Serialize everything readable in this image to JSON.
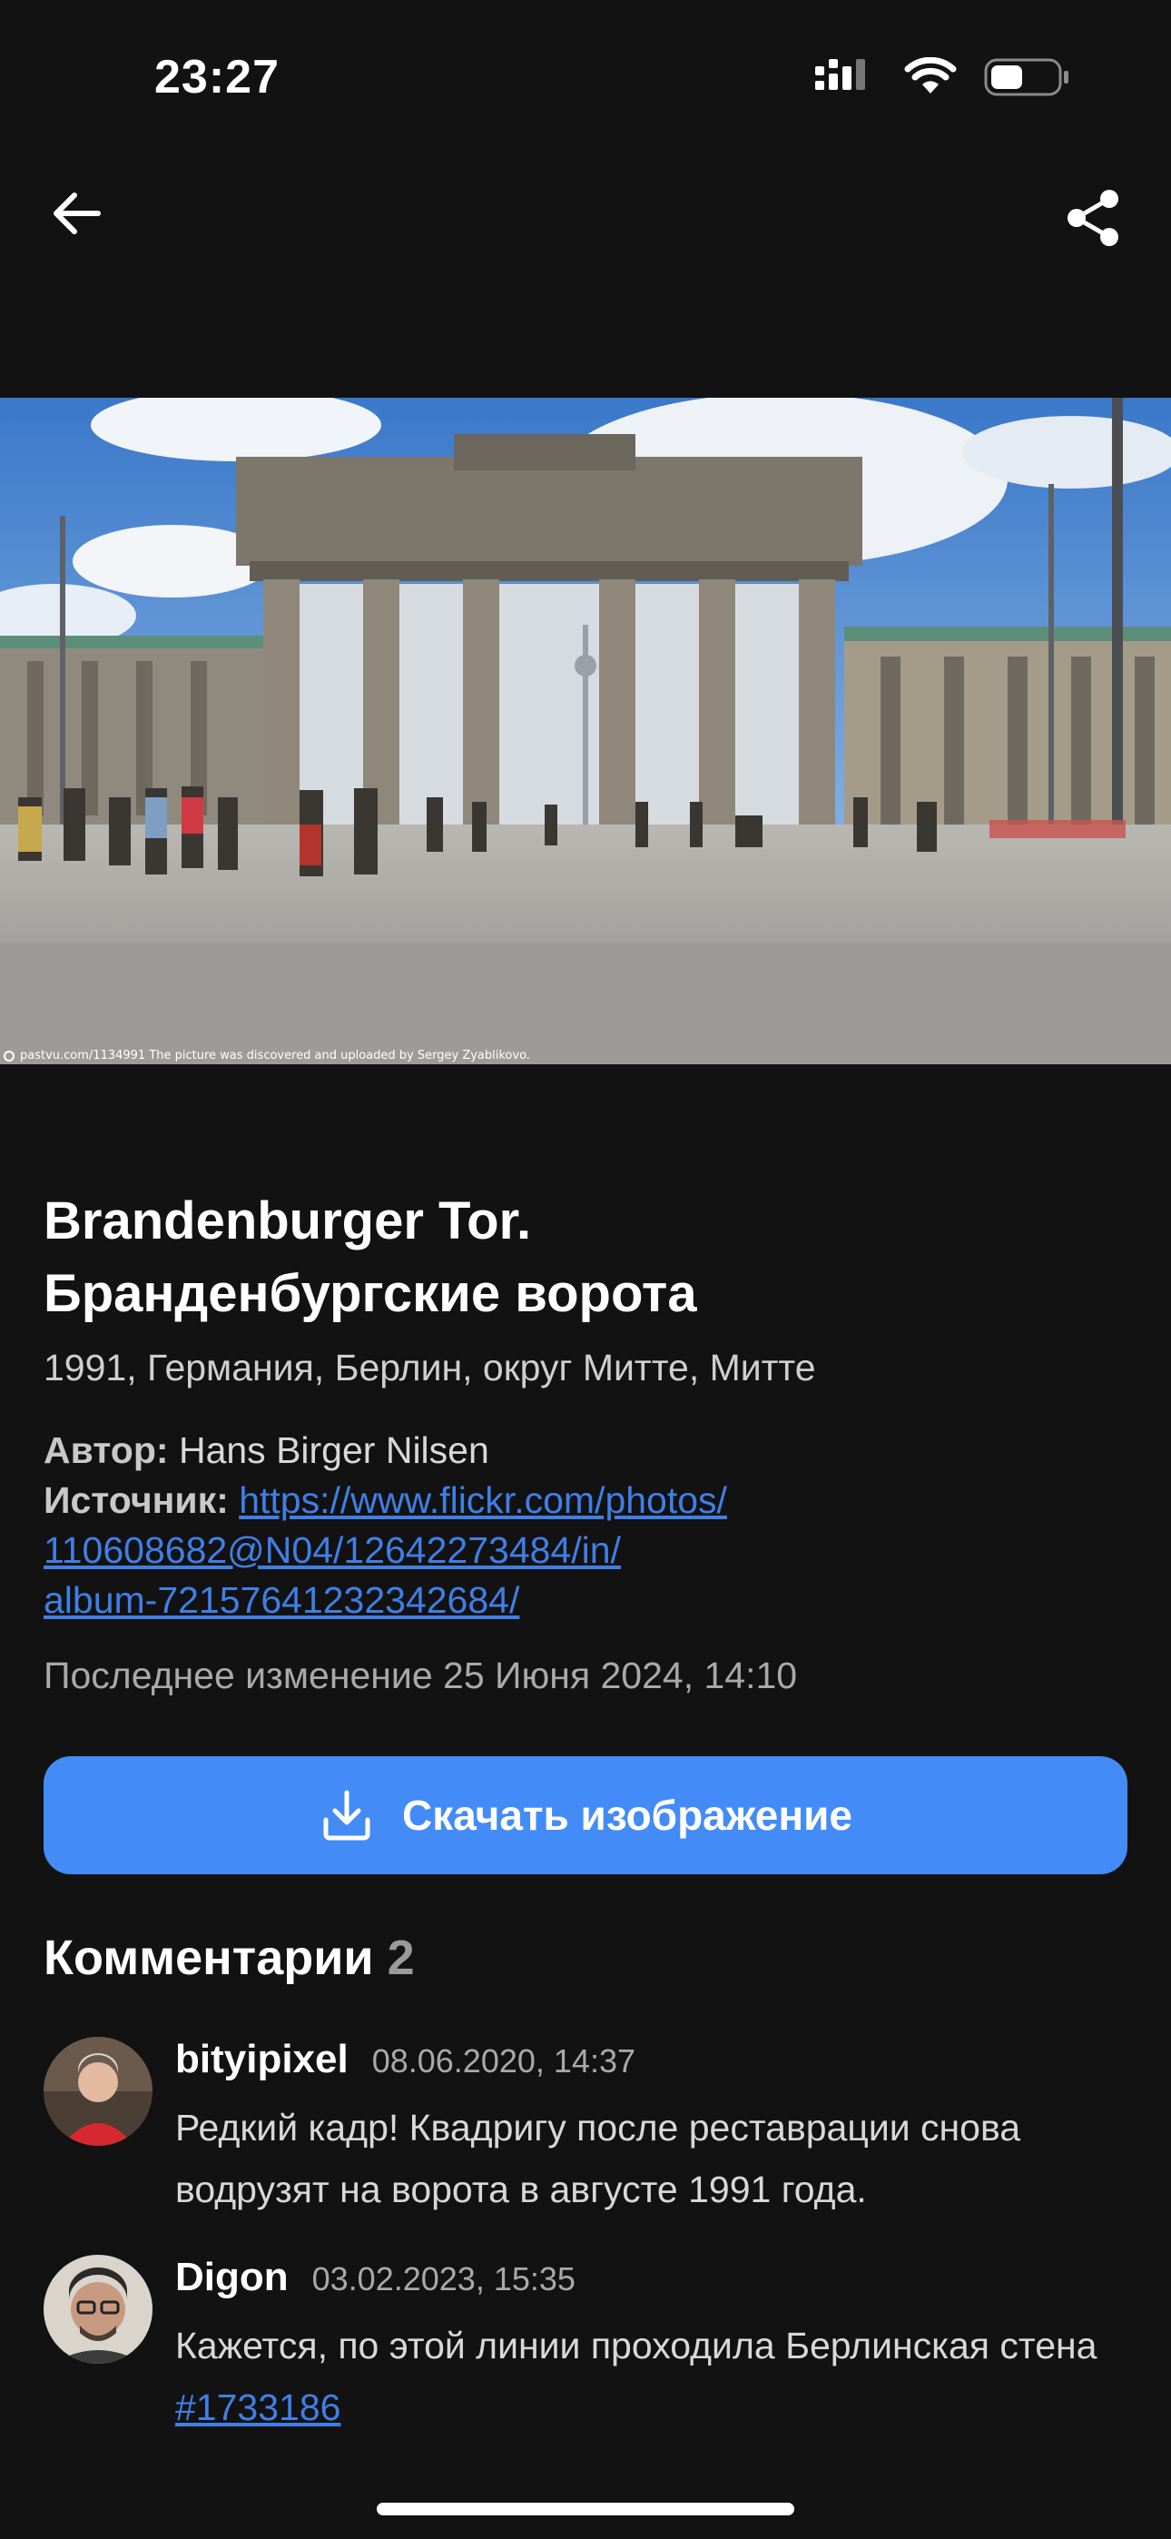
{
  "status_bar": {
    "time": "23:27"
  },
  "photo": {
    "caption": "pastvu.com/1134991  The picture was discovered and uploaded by Sergey Zyablikovo."
  },
  "details": {
    "title_line1": "Brandenburger Tor.",
    "title_line2": "Бранденбургские ворота",
    "subtitle": "1991, Германия, Берлин, округ Митте, Митте",
    "author_label": "Автор:",
    "author_value": "Hans Birger Nilsen",
    "source_label": "Источник:",
    "source_link_line1": "https://www.flickr.com/photos/",
    "source_link_line2": "110608682@N04/12642273484/in/",
    "source_link_line3": "album-72157641232342684/",
    "modified": "Последнее изменение 25 Июня 2024, 14:10"
  },
  "download": {
    "label": "Скачать изображение"
  },
  "comments": {
    "heading": "Комментарии",
    "count": "2",
    "items": [
      {
        "user": "bityipixel",
        "time": "08.06.2020, 14:37",
        "text": "Редкий кадр! Квадригу после реставрации снова водрузят на ворота в августе 1991 года."
      },
      {
        "user": "Digon",
        "time": "03.02.2023, 15:35",
        "text_before": "Кажется, по этой линии проходила Берлинская стена ",
        "link": "#1733186"
      }
    ]
  },
  "colors": {
    "background": "#121212",
    "accent": "#438cf7",
    "link": "#3f7fe6"
  }
}
